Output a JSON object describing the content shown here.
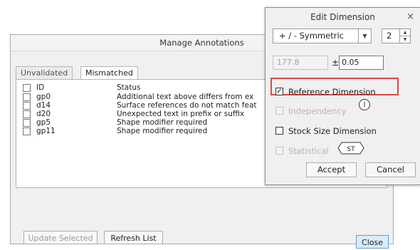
{
  "manage": {
    "title": "Manage Annotations",
    "tabs": [
      {
        "label": "Unvalidated"
      },
      {
        "label": "Mismatched"
      }
    ],
    "columns": {
      "id": "ID",
      "status": "Status"
    },
    "rows": [
      {
        "id": "gp0",
        "status": "Additional text above differs from ex"
      },
      {
        "id": "d14",
        "status": "Surface references do not match feat"
      },
      {
        "id": "d20",
        "status": "Unexpected text in prefix or suffix"
      },
      {
        "id": "gp5",
        "status": "Shape modifier required"
      },
      {
        "id": "gp11",
        "status": "Shape modifier required"
      }
    ],
    "buttons": {
      "update": "Update Selected",
      "refresh": "Refresh List",
      "close": "Close"
    }
  },
  "edit": {
    "title": "Edit Dimension",
    "close_glyph": "×",
    "tolerance_mode": "+ / - Symmetric",
    "decimals": "2",
    "nominal_value": "177.8",
    "plus_minus": "±",
    "tolerance_value": "0.05",
    "options": {
      "reference": {
        "label": "Reference Dimension",
        "checked": true,
        "glyph": "✓"
      },
      "independency": {
        "label": "Independency",
        "icon_text": "I"
      },
      "stock": {
        "label": "Stock Size Dimension",
        "checked": false
      },
      "statistical": {
        "label": "Statistical",
        "icon_text": "ST"
      }
    },
    "buttons": {
      "accept": "Accept",
      "cancel": "Cancel"
    }
  },
  "colors": {
    "highlight": "#e04646",
    "close_button": "#d8ecfa"
  }
}
